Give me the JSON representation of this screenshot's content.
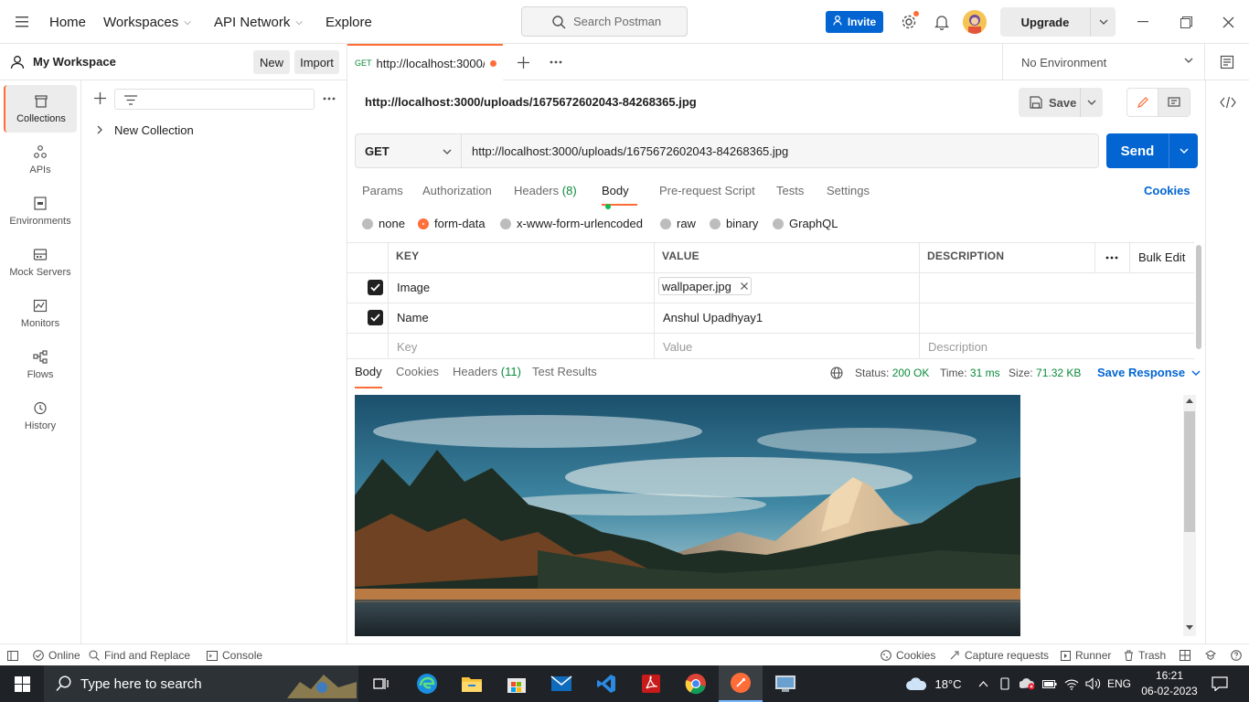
{
  "topbar": {
    "nav": [
      {
        "label": "Home"
      },
      {
        "label": "Workspaces"
      },
      {
        "label": "API Network"
      },
      {
        "label": "Explore"
      }
    ],
    "search_placeholder": "Search Postman",
    "invite_label": "Invite",
    "upgrade_label": "Upgrade"
  },
  "workspace": {
    "title": "My Workspace",
    "new_label": "New",
    "import_label": "Import"
  },
  "rail": [
    {
      "label": "Collections",
      "icon": "collections-icon"
    },
    {
      "label": "APIs",
      "icon": "apis-icon"
    },
    {
      "label": "Environments",
      "icon": "environments-icon"
    },
    {
      "label": "Mock Servers",
      "icon": "mock-servers-icon"
    },
    {
      "label": "Monitors",
      "icon": "monitors-icon"
    },
    {
      "label": "Flows",
      "icon": "flows-icon"
    },
    {
      "label": "History",
      "icon": "history-icon"
    }
  ],
  "sidebar": {
    "collections": [
      {
        "label": "New Collection"
      }
    ]
  },
  "tabs": [
    {
      "method": "GET",
      "label": "http://localhost:3000/u"
    }
  ],
  "environment": {
    "selected": "No Environment"
  },
  "request": {
    "title": "http://localhost:3000/uploads/1675672602043-84268365.jpg",
    "save_label": "Save",
    "method": "GET",
    "url": "http://localhost:3000/uploads/1675672602043-84268365.jpg",
    "send_label": "Send",
    "tabs": [
      {
        "label": "Params"
      },
      {
        "label": "Authorization"
      },
      {
        "label": "Headers",
        "count": "(8)"
      },
      {
        "label": "Body"
      },
      {
        "label": "Pre-request Script"
      },
      {
        "label": "Tests"
      },
      {
        "label": "Settings"
      }
    ],
    "cookies_label": "Cookies",
    "body_modes": [
      {
        "label": "none"
      },
      {
        "label": "form-data"
      },
      {
        "label": "x-www-form-urlencoded"
      },
      {
        "label": "raw"
      },
      {
        "label": "binary"
      },
      {
        "label": "GraphQL"
      }
    ],
    "selected_body_mode": "form-data",
    "table": {
      "headers": [
        "KEY",
        "VALUE",
        "DESCRIPTION"
      ],
      "bulk_edit_label": "Bulk Edit",
      "rows": [
        {
          "key": "Image",
          "value": "wallpaper.jpg",
          "checked": true
        },
        {
          "key": "Name",
          "value": "Anshul Upadhyay1",
          "checked": true
        }
      ],
      "placeholder": {
        "key": "Key",
        "value": "Value",
        "description": "Description"
      }
    }
  },
  "response": {
    "tabs": [
      {
        "label": "Body"
      },
      {
        "label": "Cookies"
      },
      {
        "label": "Headers",
        "count": "(11)"
      },
      {
        "label": "Test Results"
      }
    ],
    "status_label": "Status:",
    "status_value": "200 OK",
    "time_label": "Time:",
    "time_value": "31 ms",
    "size_label": "Size:",
    "size_value": "71.32 KB",
    "save_response_label": "Save Response"
  },
  "statusbar": {
    "online": "Online",
    "find_replace": "Find and Replace",
    "console": "Console",
    "cookies": "Cookies",
    "capture": "Capture requests",
    "runner": "Runner",
    "trash": "Trash"
  },
  "taskbar": {
    "search_placeholder": "Type here to search",
    "temperature": "18°C",
    "language": "ENG",
    "time": "16:21",
    "date": "06-02-2023"
  },
  "colors": {
    "accent": "#ff6c37",
    "primary": "#0265d2",
    "status_ok": "#0a8a3a"
  }
}
